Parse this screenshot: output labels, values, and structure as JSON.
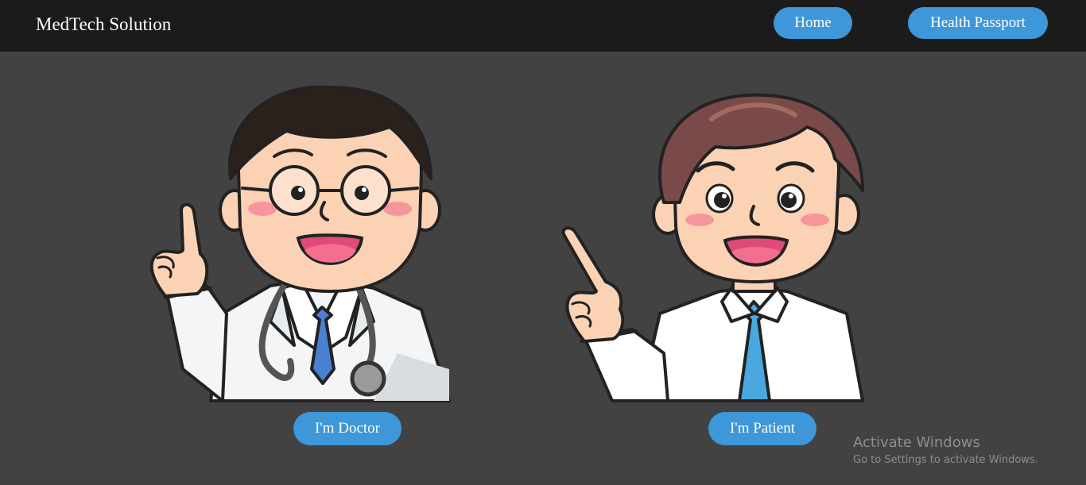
{
  "header": {
    "brand": "MedTech Solution",
    "nav": {
      "home_label": "Home",
      "health_passport_label": "Health Passport"
    }
  },
  "main": {
    "doctor": {
      "illustration": "doctor-cartoon-icon",
      "button_label": "I'm Doctor"
    },
    "patient": {
      "illustration": "patient-cartoon-icon",
      "button_label": "I'm Patient"
    }
  },
  "watermark": {
    "title": "Activate Windows",
    "subtitle": "Go to Settings to activate Windows."
  },
  "colors": {
    "navbar_bg": "#1b1b1b",
    "page_bg": "#434242",
    "accent": "#3d97d8"
  }
}
